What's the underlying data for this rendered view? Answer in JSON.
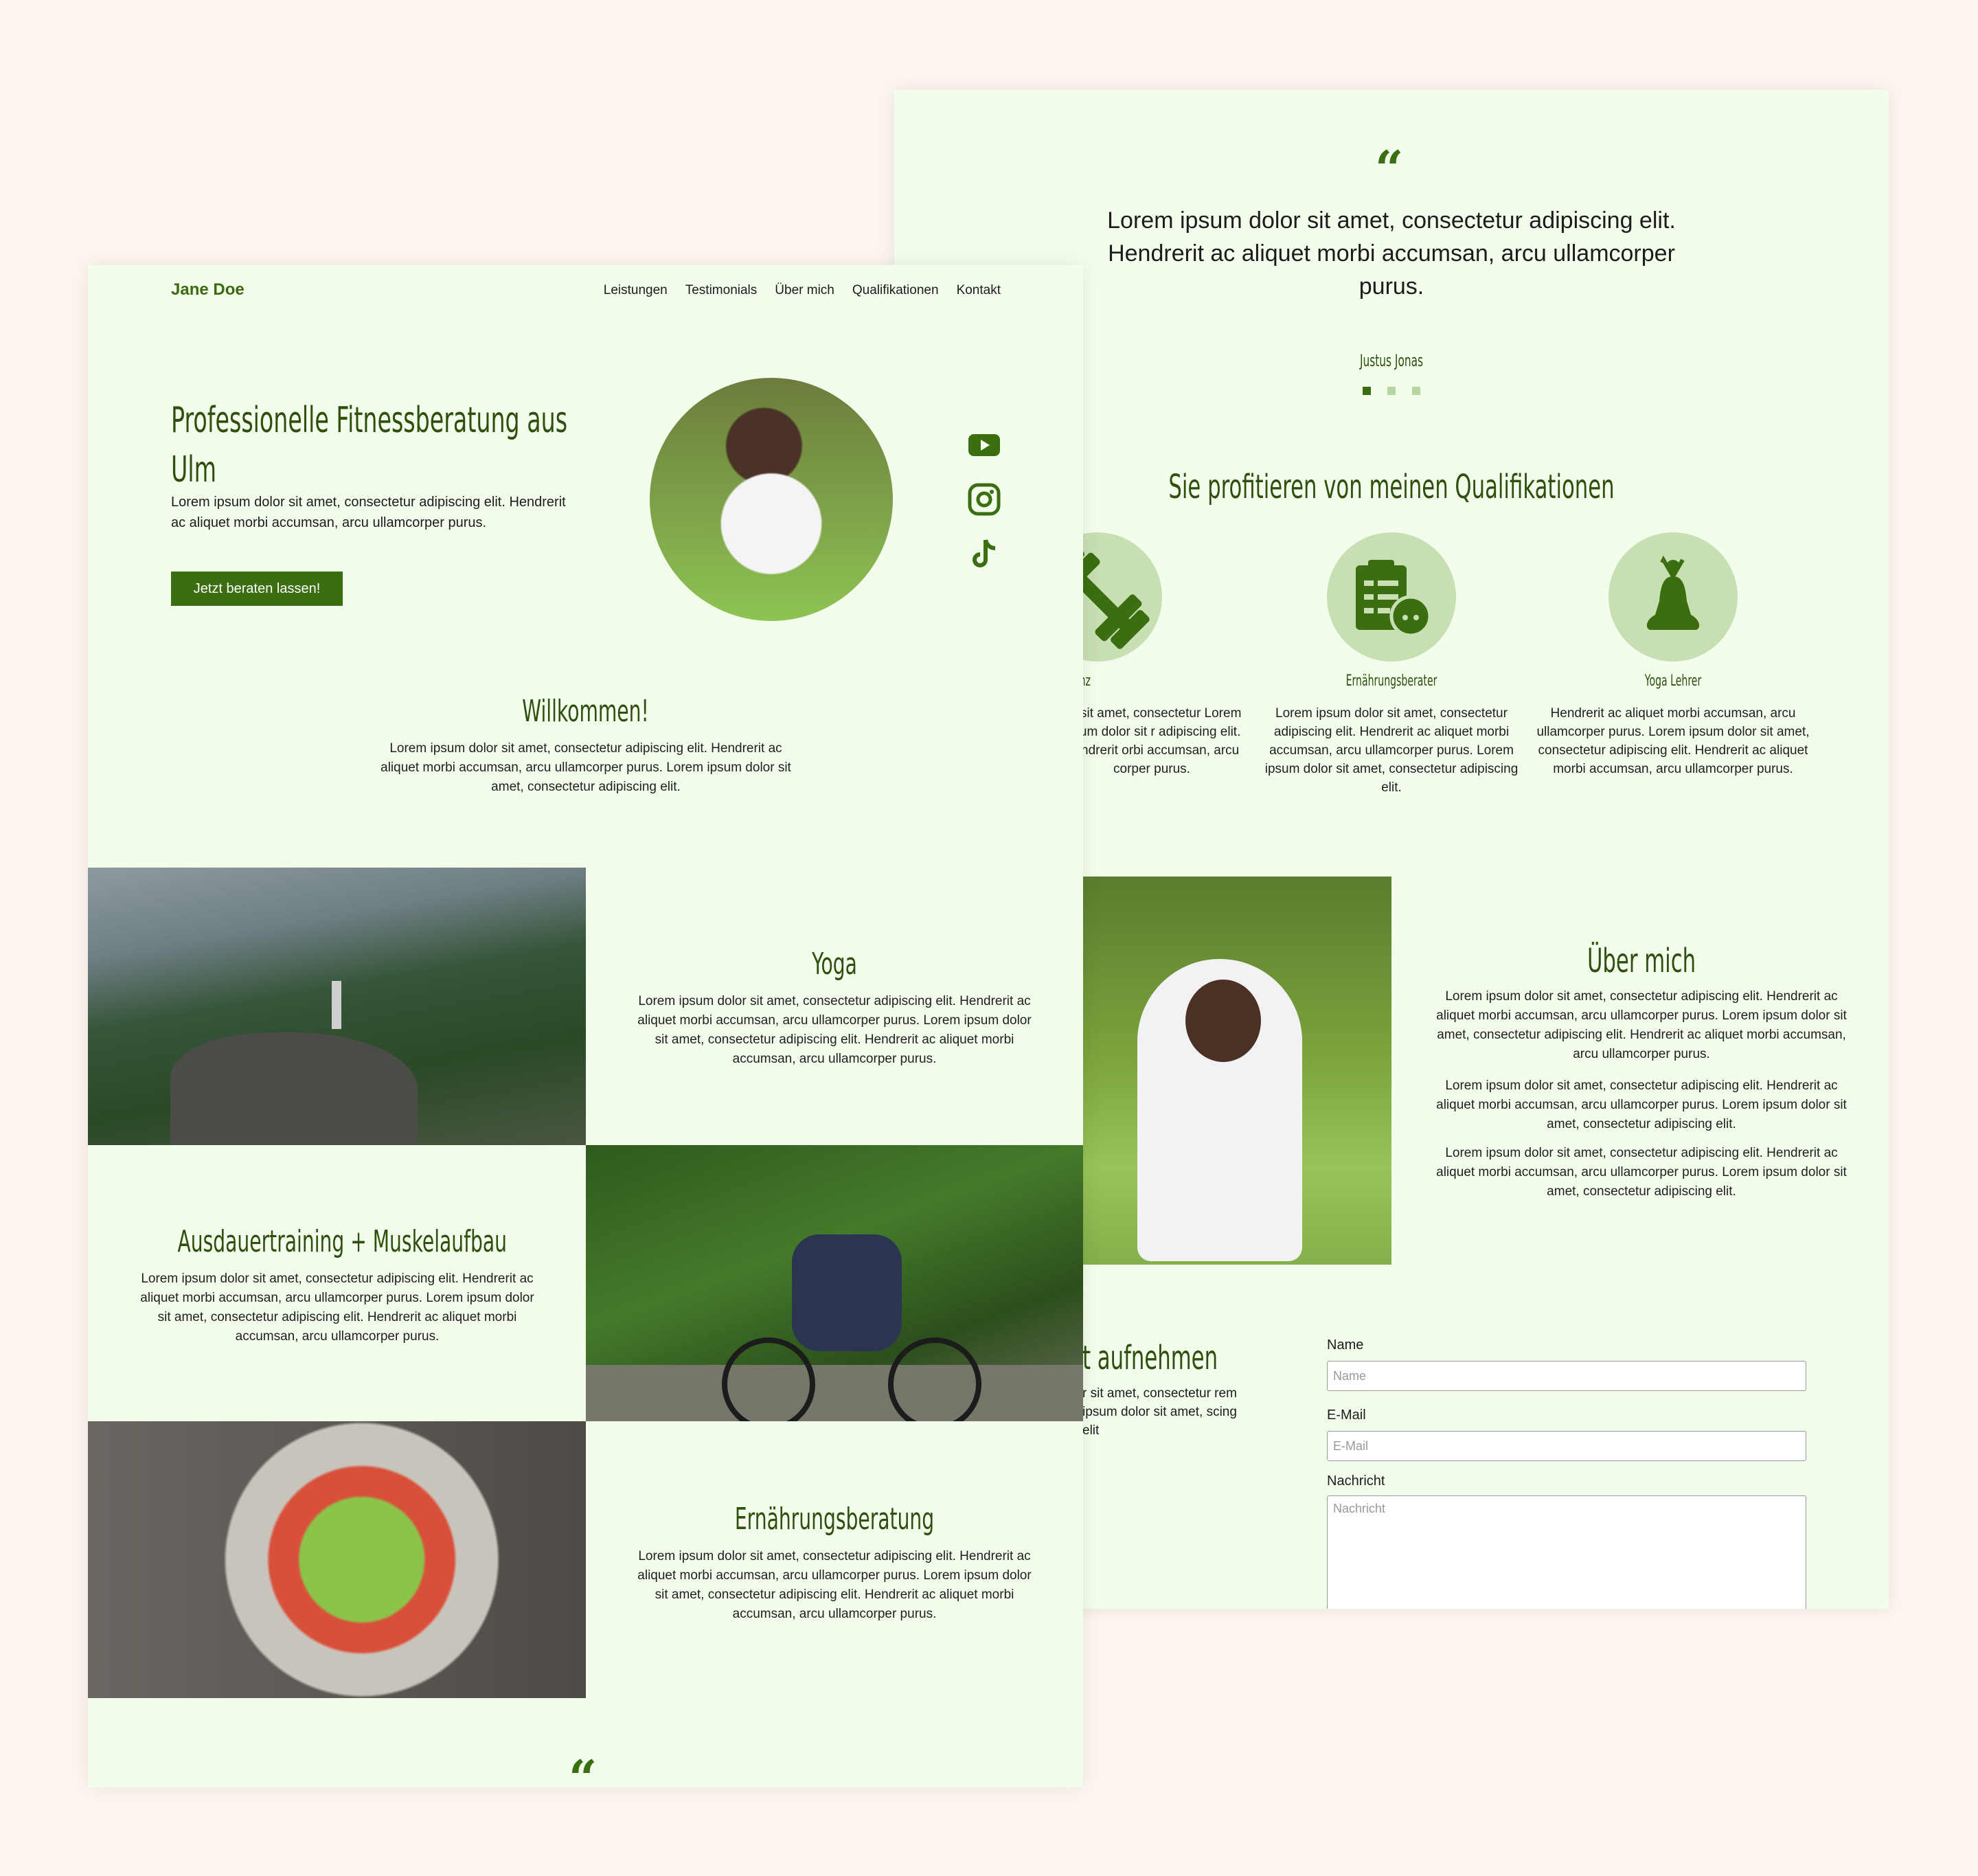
{
  "colors": {
    "background": "#fdf6f0",
    "page": "#f3fdec",
    "accent": "#3b6e10",
    "circle": "#c8dfb3"
  },
  "front": {
    "logo": "Jane Doe",
    "nav": [
      "Leistungen",
      "Testimonials",
      "Über mich",
      "Qualifikationen",
      "Kontakt"
    ],
    "hero": {
      "title": "Professionelle Fitnessberatung aus Ulm",
      "text": "Lorem ipsum dolor sit amet, consectetur adipiscing elit. Hendrerit ac aliquet morbi accumsan, arcu ullamcorper purus.",
      "cta": "Jetzt beraten lassen!"
    },
    "social": [
      "youtube-icon",
      "instagram-icon",
      "tiktok-icon"
    ],
    "welcome": {
      "title": "Willkommen!",
      "text": "Lorem ipsum dolor sit amet, consectetur adipiscing elit. Hendrerit ac aliquet morbi accumsan, arcu ullamcorper purus. Lorem ipsum dolor sit amet, consectetur adipiscing elit."
    },
    "services": [
      {
        "title": "Yoga",
        "text": "Lorem ipsum dolor sit amet, consectetur adipiscing elit. Hendrerit ac aliquet morbi accumsan, arcu ullamcorper purus. Lorem ipsum dolor sit amet, consectetur adipiscing elit. Hendrerit ac aliquet morbi accumsan, arcu ullamcorper purus."
      },
      {
        "title": "Ausdauertraining + Muskelaufbau",
        "text": "Lorem ipsum dolor sit amet, consectetur adipiscing elit. Hendrerit ac aliquet morbi accumsan, arcu ullamcorper purus. Lorem ipsum dolor sit amet, consectetur adipiscing elit. Hendrerit ac aliquet morbi accumsan, arcu ullamcorper purus."
      },
      {
        "title": "Ernährungsberatung",
        "text": "Lorem ipsum dolor sit amet, consectetur adipiscing elit. Hendrerit ac aliquet morbi accumsan, arcu ullamcorper purus. Lorem ipsum dolor sit amet, consectetur adipiscing elit. Hendrerit ac aliquet morbi accumsan, arcu ullamcorper purus."
      }
    ],
    "quote_mark": "“"
  },
  "back": {
    "quote_mark": "“",
    "testimonial": {
      "text": "Lorem ipsum dolor sit amet, consectetur adipiscing elit. Hendrerit ac aliquet morbi accumsan, arcu ullamcorper purus.",
      "author": "Justus Jonas"
    },
    "qualifications": {
      "title": "Sie profitieren von meinen Qualifikationen",
      "items": [
        {
          "title": "strainer B-Lizenz",
          "text": "lor sit amet, consectetur Lorem ipsum dolor sit r adipiscing elit. Hendrerit orbi accumsan, arcu corper purus."
        },
        {
          "title": "Ernährungsberater",
          "text": "Lorem ipsum dolor sit amet, consectetur adipiscing elit. Hendrerit ac aliquet morbi accumsan, arcu ullamcorper purus. Lorem ipsum dolor sit amet, consectetur adipiscing elit."
        },
        {
          "title": "Yoga Lehrer",
          "text": "Hendrerit ac aliquet morbi accumsan, arcu ullamcorper purus. Lorem ipsum dolor sit amet, consectetur adipiscing elit. Hendrerit ac aliquet morbi accumsan, arcu ullamcorper purus."
        }
      ]
    },
    "about": {
      "title": "Über mich",
      "paragraphs": [
        "Lorem ipsum dolor sit amet, consectetur adipiscing elit. Hendrerit ac aliquet morbi accumsan, arcu ullamcorper purus. Lorem ipsum dolor sit amet, consectetur adipiscing elit. Hendrerit ac aliquet morbi accumsan, arcu ullamcorper purus.",
        "Lorem ipsum dolor sit amet, consectetur adipiscing elit. Hendrerit ac aliquet morbi accumsan, arcu ullamcorper purus. Lorem ipsum dolor sit amet, consectetur adipiscing elit.",
        "Lorem ipsum dolor sit amet, consectetur adipiscing elit. Hendrerit ac aliquet morbi accumsan, arcu ullamcorper purus. Lorem ipsum dolor sit amet, consectetur adipiscing elit."
      ]
    },
    "contact": {
      "title": "t aufnehmen",
      "text": "r sit amet, consectetur rem ipsum dolor sit amet, scing elit",
      "fields": {
        "name_label": "Name",
        "name_placeholder": "Name",
        "email_label": "E-Mail",
        "email_placeholder": "E-Mail",
        "message_label": "Nachricht",
        "message_placeholder": "Nachricht"
      }
    }
  }
}
